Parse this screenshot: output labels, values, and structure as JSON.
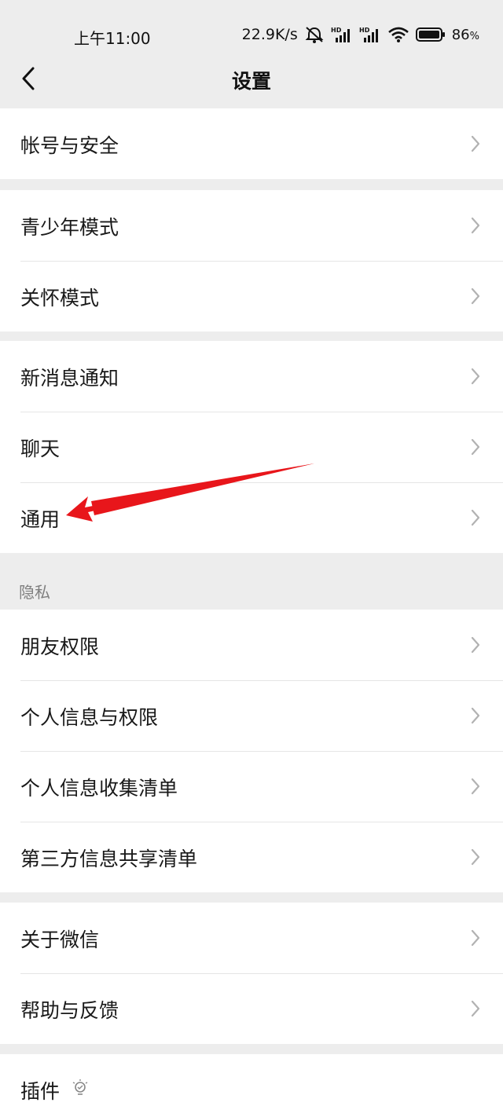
{
  "status_bar": {
    "time": "上午11:00",
    "network_speed": "22.9K/s",
    "battery_percent": "86",
    "icons": [
      "alarm-off-icon",
      "signal-hd-icon",
      "signal-hd-icon",
      "wifi-icon",
      "battery-icon"
    ]
  },
  "header": {
    "title": "设置",
    "back_icon": "back-chevron-icon"
  },
  "groups": {
    "account": [
      {
        "label": "帐号与安全"
      }
    ],
    "modes": [
      {
        "label": "青少年模式"
      },
      {
        "label": "关怀模式"
      }
    ],
    "general": [
      {
        "label": "新消息通知"
      },
      {
        "label": "聊天"
      },
      {
        "label": "通用"
      }
    ],
    "privacy_header": "隐私",
    "privacy": [
      {
        "label": "朋友权限"
      },
      {
        "label": "个人信息与权限"
      },
      {
        "label": "个人信息收集清单"
      },
      {
        "label": "第三方信息共享清单"
      }
    ],
    "about": [
      {
        "label": "关于微信"
      },
      {
        "label": "帮助与反馈"
      }
    ],
    "plugins": [
      {
        "label": "插件"
      }
    ]
  },
  "colors": {
    "background": "#ededed",
    "row_background": "#ffffff",
    "annotation_arrow": "#e8161b"
  }
}
